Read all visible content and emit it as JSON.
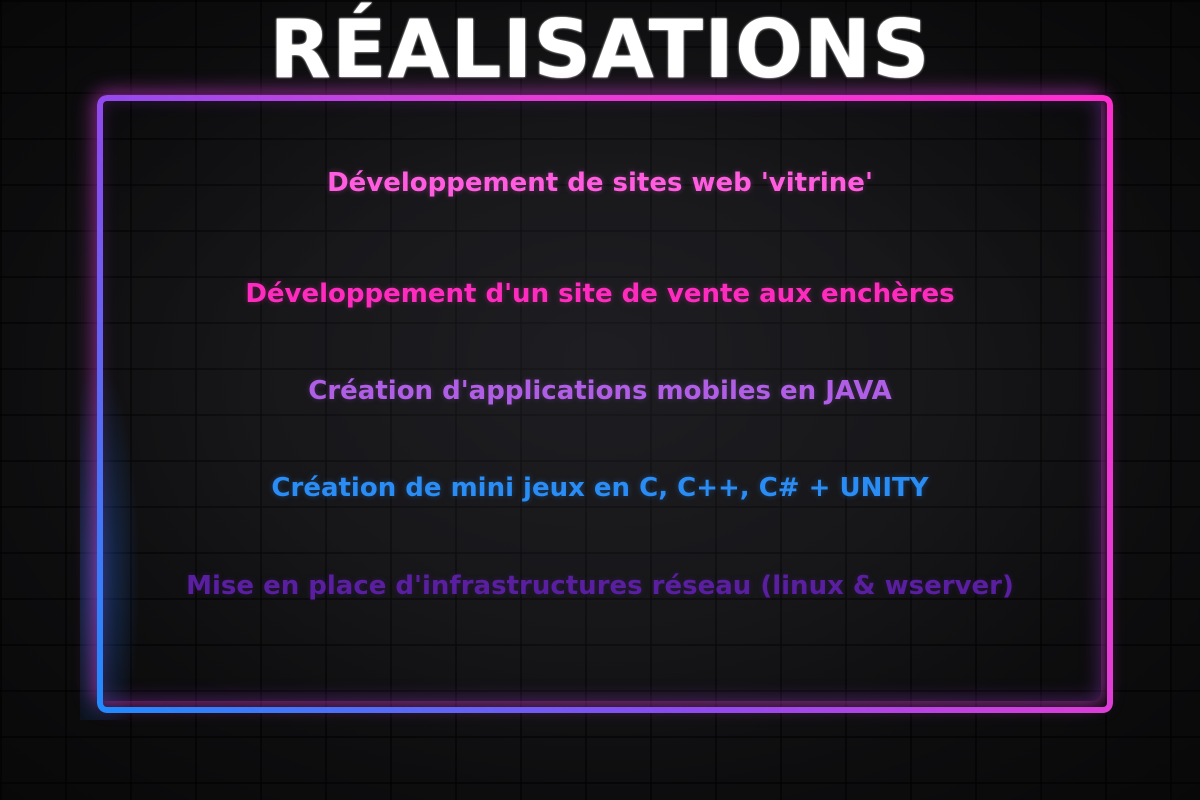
{
  "title": "RÉALISATIONS",
  "items": [
    {
      "label": "Développement de sites web 'vitrine'",
      "color": "#ff5ce0"
    },
    {
      "label": "Développement d'un site de vente aux enchères",
      "color": "#ff2bbf"
    },
    {
      "label": "Création d'applications mobiles en JAVA",
      "color": "#b05ee6"
    },
    {
      "label": "Création de mini jeux en C, C++, C# + UNITY",
      "color": "#2a8cf5"
    },
    {
      "label": "Mise en place d'infrastructures réseau (linux & wserver)",
      "color": "#5a1fa0"
    }
  ],
  "colors": {
    "background": "#121214",
    "frame_top": "#ff2ccf",
    "frame_bottom": "#1f8cff",
    "title": "#ffffff"
  }
}
